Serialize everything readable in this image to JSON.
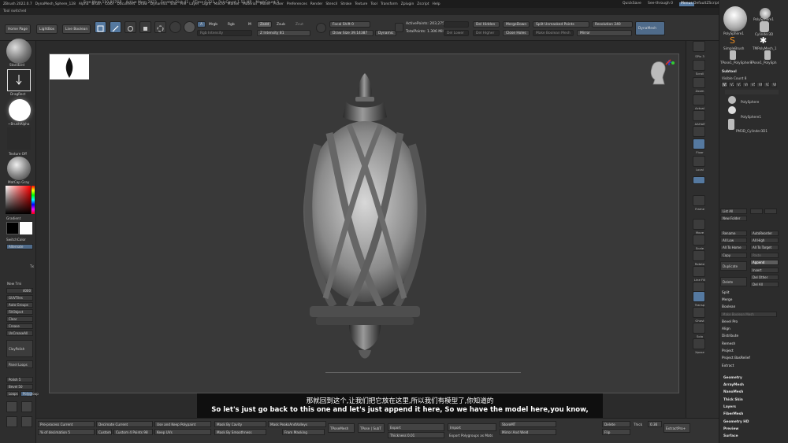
{
  "menu": [
    "ZBrush 2022.0.7",
    "DynaMesh_Sphere_128",
    "Alpha",
    "Brush",
    "Color",
    "Document",
    "Draw",
    "Dynamics",
    "Edit",
    "File",
    "Layer",
    "Light",
    "Macro",
    "Marker",
    "Material",
    "Movie",
    "Picker",
    "Preferences",
    "Render",
    "Stencil",
    "Stroke",
    "Texture",
    "Tool",
    "Transform",
    "Zplugin",
    "Zscript",
    "Help"
  ],
  "menu_right": [
    "QuickSave",
    "See-through 0",
    "Menus",
    "DefaultZScript"
  ],
  "status": [
    "Free Mem 110.807GB",
    "Active Mem 2023",
    "Scratch Disk 41",
    "ATime 0.321",
    "PolyCount 1.51 MP",
    "MeshCount 3"
  ],
  "status_tool": "Tool switched",
  "toolbar": {
    "home_page": "Home Page",
    "lightbox": "LightBox",
    "live_boolean": "Live Boolean",
    "edit": "Edit",
    "draw": "Draw",
    "move": "Move",
    "scale": "Scale",
    "rotate": "Rotate",
    "a": "A",
    "mrgb": "Mrgb",
    "rgb": "Rgb",
    "m": "M",
    "rgb_intensity": "Rgb Intensity",
    "zadd": "Zadd",
    "zsub": "Zsub",
    "zcut": "Zcut",
    "z_intensity": "Z Intensity 81",
    "focal_shift": "Focal Shift 0",
    "draw_size": "Draw Size 39.14387",
    "dynamic": "Dynamic",
    "active_points": "ActivePoints: 203,275",
    "total_points": "TotalPoints: 1.306 Mil",
    "del_hidden": "Del Hidden",
    "del_lower": "Del Lower",
    "del_higher": "Del Higher",
    "merge_down": "MergeDown",
    "close_holes": "Close Holes",
    "split_unmasked": "Split Unmasked Points",
    "make_boolean": "Make Boolean Mesh",
    "resolution": "Resolution 240",
    "mirror": "Mirror",
    "dynamesh": "DynaMesh",
    "sdiv": "SDiv",
    "geometry": "Geometry"
  },
  "left": {
    "standard": "Standard",
    "dragrect": "DragRect",
    "brushalpha": "~BrushAlpha",
    "texture_off": "Texture Off",
    "matcap": "MatCap Gray",
    "gradient": "Gradient",
    "switchcolor": "SwitchColor",
    "alternate": "Alternate",
    "new_tmi": "New Tmi",
    "val4000": "4000",
    "guvtiles": "GUVTiles",
    "auto_groups": "Auto Groups",
    "fill_object": "FillObject",
    "clear": "Clear",
    "crease": "Crease",
    "uncrease_all": "UnCreaseAll",
    "clay_polish": "ClayPolish",
    "panel_loops": "Panel Loops",
    "polish": "Polish 5",
    "bevel": "Bevel 50",
    "loops": "Loops",
    "polygroup": "Polygroup",
    "tex": "Tx"
  },
  "right_shelf": [
    "SPix 3",
    "Scroll",
    "Zoom",
    "Actual",
    "AAHalf",
    "Persp",
    "Floor",
    "Local",
    "Frame",
    "Move",
    "Scale",
    "Rotate",
    "Line Fill",
    "PolyF",
    "Transp",
    "Ghost",
    "Solo",
    "Xpose"
  ],
  "tray": {
    "tools": [
      "PolySphere1",
      "PolySphere1",
      "Cylinder3D",
      "SimpleBrush",
      "TMPolyMesh_1",
      "TPose1_PolySphere",
      "TPose1_PolySph"
    ],
    "subtool_title": "Subtool",
    "visible_count": "Visible Count 8",
    "v_buttons": [
      "V1",
      "V2",
      "V3",
      "V4",
      "V5",
      "V6",
      "V7",
      "V8"
    ],
    "subtools": [
      "PolySphere",
      "PolySphere1",
      "PM3D_Cylinder3D1"
    ],
    "list_all": "List All",
    "new_folder": "New Folder",
    "rename": "Rename",
    "auto_reorder": "AutoReorder",
    "all_low": "All Low",
    "all_high": "All High",
    "all_to_home": "All To Home",
    "all_to_target": "All To Target",
    "copy": "Copy",
    "paste": "Paste",
    "duplicate": "Duplicate",
    "append": "Append",
    "insert": "Insert",
    "delete": "Delete",
    "del_other": "Del Other",
    "del_all": "Del All",
    "split": "Split",
    "merge": "Merge",
    "boolean": "Boolean",
    "make_boolean": "Make Boolean Mesh",
    "bevel_pro": "Bevel Pro",
    "align": "Align",
    "distribute": "Distribute",
    "remesh": "Remesh",
    "project": "Project",
    "project_basrelief": "Project BasRelief",
    "extract": "Extract",
    "geometry": "Geometry",
    "arraymesh": "ArrayMesh",
    "nanomesh": "NanoMesh",
    "thick_skin": "Thick Skin",
    "layers": "Layers",
    "fibermesh": "FiberMesh",
    "geometry_hd": "Geometry HD",
    "preview": "Preview",
    "surface": "Surface"
  },
  "bottom": {
    "pre_process": "Pre-process Current",
    "pct_decimation": "% of decimation 5",
    "decimate_current": "Decimate Current",
    "custom": "Custom",
    "custom_points": "Custom 4 Points 98",
    "use_keep": "Use and Keep Polypaint",
    "keep_uvs": "Keep UVs",
    "mask_by_cavity": "Mask By Cavity",
    "mask_by_smooth": "Mask By Smoothness",
    "mask_peaks": "Mask PeaksAndValleys",
    "from_masking": "From Masking",
    "tpose_mesh": "TPoseMesh",
    "tpose_subt": "TPose | SubT",
    "export": "Export",
    "thickness": "Thickness 0.01",
    "import": "Import",
    "export_polygroups": "Export Polygroups as Mats",
    "store_mt": "StoreMT",
    "mirror_weld": "Mirror And Weld",
    "delete": "Delete",
    "flip": "Flip",
    "thick": "Thick",
    "thick_val": "0.36",
    "extract_pro": "ExtractPro+"
  },
  "subtitle": {
    "zh": "那就回到这个,让我们把它放在这里,所以我们有模型了,你知道的",
    "en": "So let's just go back to this one and let's just append it here, So we have the model here,you know,"
  },
  "colors": {
    "accent": "#5579a0",
    "bg": "#2b2b2b",
    "canvas": "#393939"
  }
}
